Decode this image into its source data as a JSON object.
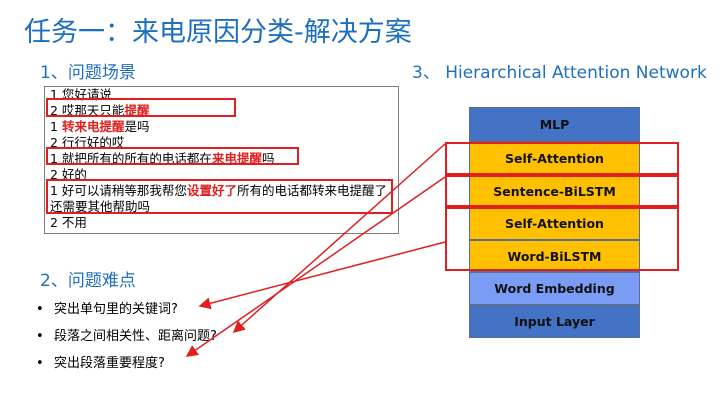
{
  "title": "任务一：来电原因分类-解决方案",
  "section1": "1、问题场景",
  "section2": "2、问题难点",
  "section3": "3、 Hierarchical Attention Network",
  "dialog": [
    {
      "text": "1 您好请说"
    },
    {
      "prefix": "2 哎那天只能",
      "hl": "提醒",
      "suffix": ""
    },
    {
      "prefix": "1 ",
      "hl": "转来电提醒",
      "suffix": "是吗"
    },
    {
      "text": "2 行行好的哎"
    },
    {
      "prefix": "1 就把所有的所有的电话都在",
      "hl": "来电提醒",
      "suffix": "吗"
    },
    {
      "text": "2 好的"
    },
    {
      "prefix": "1 好可以请稍等那我帮您",
      "hl": "设置好了",
      "suffix": "所有的电话都转来电提醒了还需要其他帮助吗"
    },
    {
      "text": "2 不用"
    }
  ],
  "bullets": [
    "突出单句里的关键词?",
    "段落之间相关性、距离问题?",
    "突出段落重要程度?"
  ],
  "bullet_symbol": "•",
  "layers": [
    {
      "label": "MLP",
      "color": "#4472c4"
    },
    {
      "label": "Self-Attention",
      "color": "#ffc000"
    },
    {
      "label": "Sentence-BiLSTM",
      "color": "#ffc000"
    },
    {
      "label": "Self-Attention",
      "color": "#ffc000"
    },
    {
      "label": "Word-BiLSTM",
      "color": "#ffc000"
    },
    {
      "label": "Word Embedding",
      "color": "#7b9cf5"
    },
    {
      "label": "Input Layer",
      "color": "#4472c4"
    }
  ],
  "highlight_color": "#e02020",
  "accent_color": "#1f6fbf"
}
